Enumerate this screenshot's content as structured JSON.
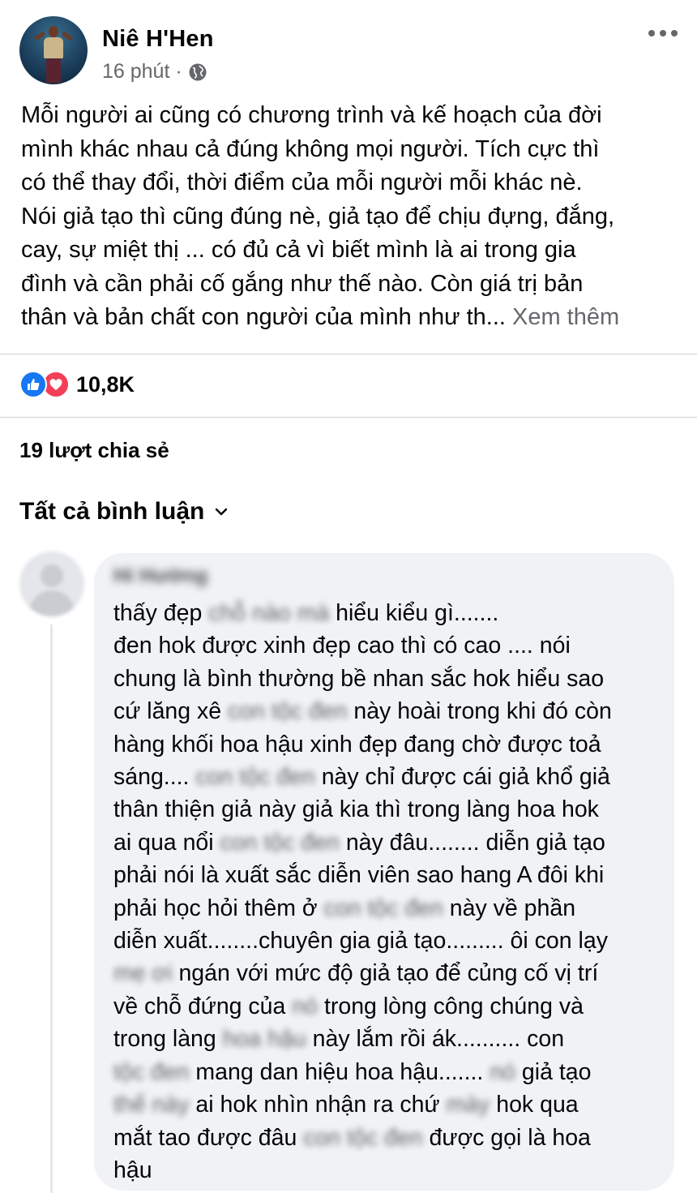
{
  "post": {
    "author_name": "Niê H'Hen",
    "timestamp": "16 phút",
    "separator": "·",
    "text_lines": [
      "Mỗi người ai cũng có chương trình và kế hoạch của đời",
      "mình khác nhau cả đúng không mọi người. Tích cực thì",
      "có thể thay đổi, thời điểm của mỗi người mỗi khác nè.",
      "Nói giả tạo thì cũng đúng nè, giả tạo để chịu đựng, đắng,",
      "cay, sự miệt thị ... có đủ cả vì biết mình là ai trong gia",
      "đình và cần phải cố gắng như thế nào. Còn giá trị bản",
      "thân và bản chất con người của mình như th..."
    ],
    "see_more": "Xem thêm"
  },
  "reactions": {
    "count": "10,8K",
    "types": [
      "like-icon",
      "love-icon"
    ],
    "like_color": "#1877f2",
    "love_color": "#f33e58"
  },
  "shares": {
    "label": "19 lượt chia sẻ"
  },
  "comments": {
    "filter_label": "Tất cả bình luận",
    "items": [
      {
        "author_name": "Hi Hường",
        "lines": [
          [
            "thấy đẹp",
            {
              "blur": "chỗ nào mà"
            },
            "hiểu kiểu gì......."
          ],
          [
            "đen hok được xinh đẹp cao thì có cao .... nói"
          ],
          [
            "chung là bình thường bề nhan sắc hok hiểu sao"
          ],
          [
            "cứ lăng xê",
            {
              "blur": "con tộc đen"
            },
            "này hoài trong khi đó còn"
          ],
          [
            "hàng khối hoa hậu xinh đẹp đang chờ được toả"
          ],
          [
            "sáng....",
            {
              "blur": "con tộc đen"
            },
            "này chỉ được cái giả khổ giả"
          ],
          [
            "thân thiện giả này giả kia thì trong làng hoa hok"
          ],
          [
            "ai qua nổi",
            {
              "blur": "con tộc đen"
            },
            "này đâu........ diễn giả tạo"
          ],
          [
            "phải nói là xuất sắc diễn viên sao hang A đôi khi"
          ],
          [
            "phải học hỏi thêm ở",
            {
              "blur": "con tộc đen"
            },
            "này về phần"
          ],
          [
            "diễn xuất........chuyên gia giả tạo......... ôi con lạy"
          ],
          [
            {
              "blur": "mẹ ơi"
            },
            "ngán với mức độ giả tạo để củng cố vị trí"
          ],
          [
            "về chỗ đứng của",
            {
              "blur": "nó"
            },
            "trong lòng công chúng và"
          ],
          [
            "trong làng",
            {
              "blur": "hoa hậu"
            },
            "này lắm rồi ák.......... con"
          ],
          [
            {
              "blur": "tộc đen"
            },
            "mang dan hiệu  hoa hậu.......",
            {
              "blur": "nó"
            },
            "giả tạo"
          ],
          [
            {
              "blur": "thế này"
            },
            "ai hok nhìn nhận ra chứ",
            {
              "blur": "mày"
            },
            "hok qua"
          ],
          [
            "mắt tao được đâu",
            {
              "blur": "con tộc đen"
            },
            "được gọi là hoa"
          ],
          [
            "hậu"
          ]
        ]
      }
    ]
  },
  "colors": {
    "text_primary": "#050505",
    "text_secondary": "#65676b",
    "bubble_bg": "#f0f2f5",
    "divider": "#ced0d4"
  }
}
